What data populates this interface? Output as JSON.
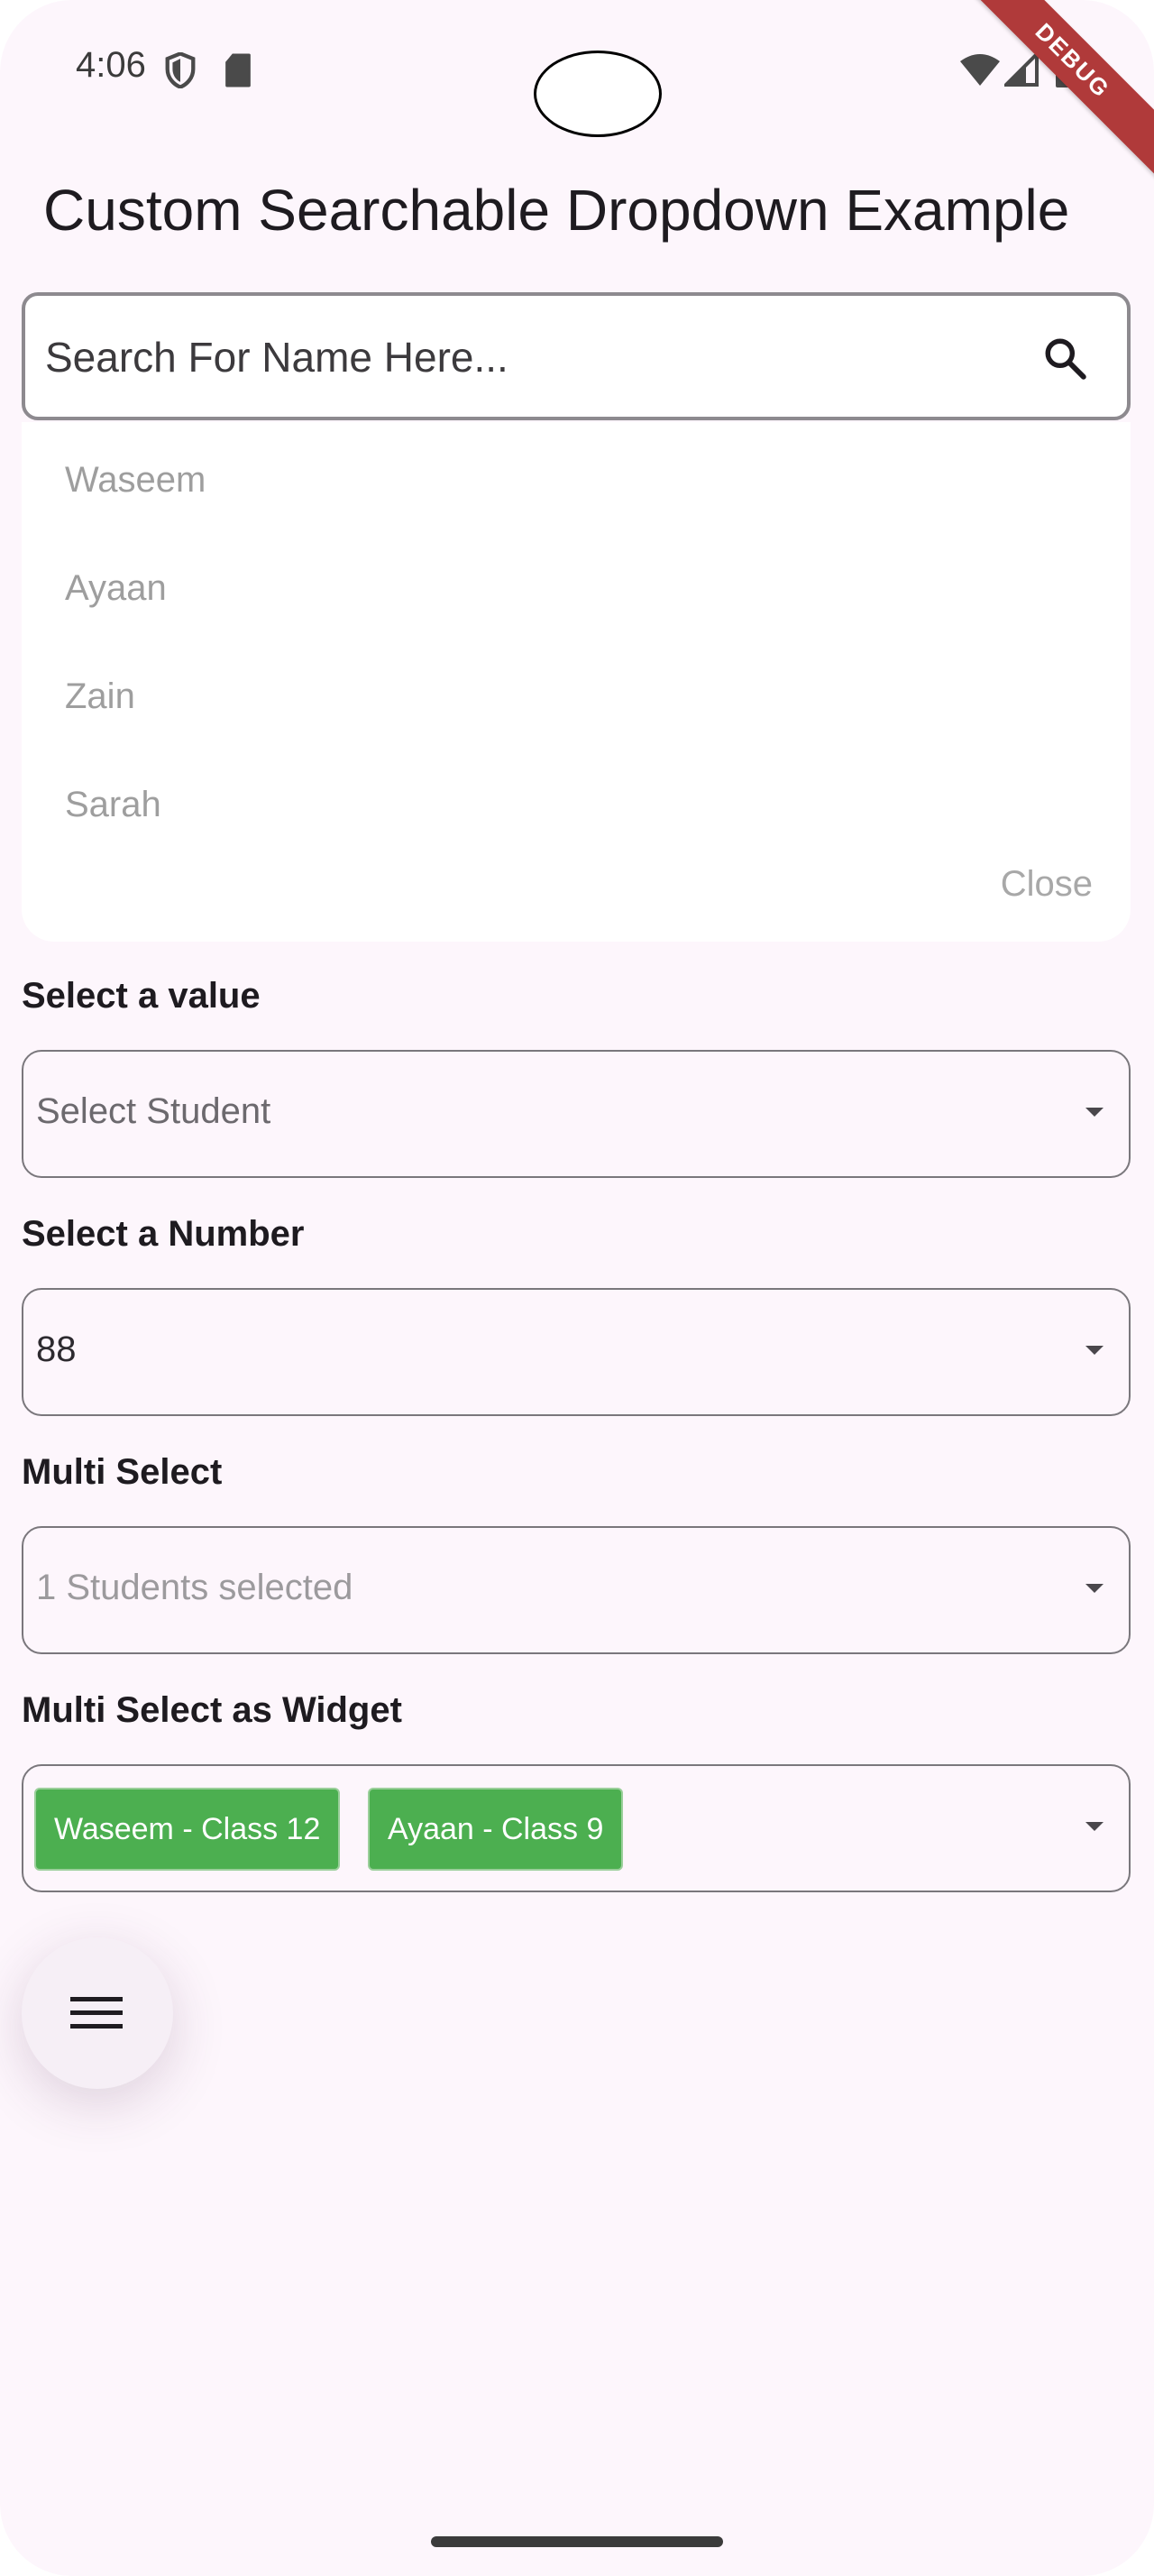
{
  "status_bar": {
    "time": "4:06",
    "icons": [
      "shield-icon",
      "sd-card-icon",
      "wifi-icon",
      "signal-icon",
      "battery-icon"
    ]
  },
  "debug_banner": "DEBUG",
  "page": {
    "title": "Custom Searchable Dropdown Example"
  },
  "search": {
    "placeholder": "Search For Name Here...",
    "icon": "search-icon"
  },
  "dropdown": {
    "items": [
      "Waseem",
      "Ayaan",
      "Zain",
      "Sarah"
    ],
    "close_label": "Close"
  },
  "fields": {
    "select_value": {
      "label": "Select a value",
      "value": "Select Student"
    },
    "select_number": {
      "label": "Select a Number",
      "value": "88"
    },
    "multi_select": {
      "label": "Multi Select",
      "value": "1 Students selected"
    },
    "multi_select_widget": {
      "label": "Multi Select as Widget",
      "chips": [
        "Waseem - Class 12",
        "Ayaan - Class 9"
      ]
    }
  },
  "fab": {
    "icon": "menu-icon"
  },
  "colors": {
    "background": "#fdf6fc",
    "chip": "#4caf50",
    "debug": "#b03a3a"
  }
}
